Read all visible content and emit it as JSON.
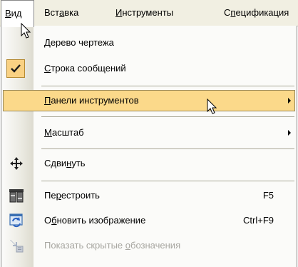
{
  "menubar": {
    "items": [
      {
        "pre": "",
        "u": "В",
        "post": "ид"
      },
      {
        "pre": "Вст",
        "u": "а",
        "post": "вка"
      },
      {
        "pre": "",
        "u": "И",
        "post": "нструменты"
      },
      {
        "pre": "С",
        "u": "п",
        "post": "ецификация"
      }
    ]
  },
  "menu": {
    "tree": {
      "pre": "",
      "u": "Д",
      "post": "ерево чертежа"
    },
    "status": {
      "pre": "",
      "u": "С",
      "post": "трока сообщений"
    },
    "toolbars": {
      "pre": "",
      "u": "П",
      "post": "анели инструментов"
    },
    "zoom": {
      "pre": "",
      "u": "М",
      "post": "асштаб"
    },
    "pan": {
      "pre": "Сдви",
      "u": "н",
      "post": "уть"
    },
    "rebuild": {
      "pre": "Пе",
      "u": "р",
      "post": "естроить",
      "shortcut": "F5"
    },
    "refresh": {
      "pre": "О",
      "u": "б",
      "post": "новить изображение",
      "shortcut": "Ctrl+F9"
    },
    "hidden": {
      "pre": "Показать скрытые ",
      "u": "о",
      "post": "бозначения"
    }
  },
  "colors": {
    "menu_highlight": "#fbd98a",
    "checked_background": "#f9d183",
    "disabled_text": "#a7a6a0"
  }
}
